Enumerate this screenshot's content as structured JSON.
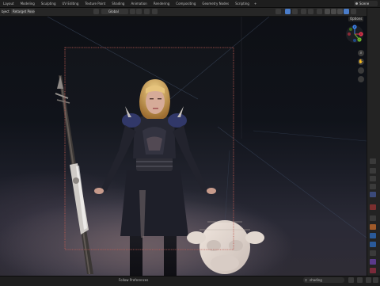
{
  "workspace_tabs": [
    "Layout",
    "Modeling",
    "Sculpting",
    "UV Editing",
    "Texture Paint",
    "Shading",
    "Animation",
    "Rendering",
    "Compositing",
    "Geometry Nodes",
    "Scripting"
  ],
  "header": {
    "object_label": "bject",
    "object_mode": "Retarget Pose",
    "transform_orientation": "Global",
    "options_label": "Options"
  },
  "scene": {
    "name": "Scene"
  },
  "gizmo": {
    "x_label": "X",
    "y_label": "Y",
    "z_label": "Z"
  },
  "colors": {
    "accent": "#4a7cc9",
    "axis_x": "#e0354d",
    "axis_y": "#6bb32b",
    "axis_z": "#3b7ee2",
    "camera_frame": "#c05b52"
  },
  "status": {
    "center_text": "Follow Preferences",
    "search_placeholder": "shading"
  },
  "icons": [
    "collection-icon",
    "snap-icon",
    "gizmo-icon",
    "overlay-icon",
    "xray-icon",
    "shading-icon",
    "zoom-icon",
    "pan-icon",
    "camera-view-icon",
    "grid-icon",
    "search-icon"
  ]
}
